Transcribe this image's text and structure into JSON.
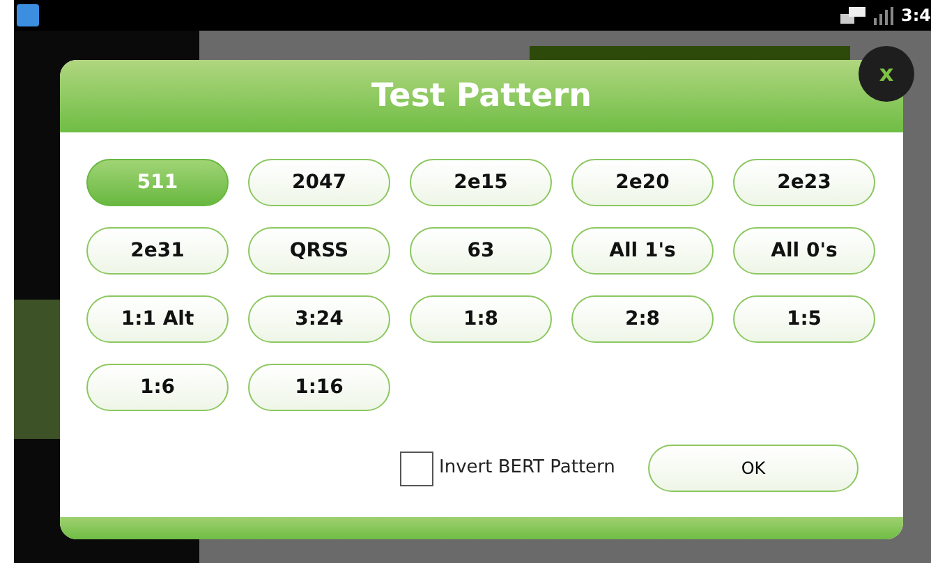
{
  "status_bar": {
    "time": "3:4"
  },
  "dialog": {
    "title": "Test Pattern",
    "close": "x",
    "patterns": [
      {
        "label": "511",
        "selected": true
      },
      {
        "label": "2047",
        "selected": false
      },
      {
        "label": "2e15",
        "selected": false
      },
      {
        "label": "2e20",
        "selected": false
      },
      {
        "label": "2e23",
        "selected": false
      },
      {
        "label": "2e31",
        "selected": false
      },
      {
        "label": "QRSS",
        "selected": false
      },
      {
        "label": "63",
        "selected": false
      },
      {
        "label": "All 1's",
        "selected": false
      },
      {
        "label": "All 0's",
        "selected": false
      },
      {
        "label": "1:1 Alt",
        "selected": false
      },
      {
        "label": "3:24",
        "selected": false
      },
      {
        "label": "1:8",
        "selected": false
      },
      {
        "label": "2:8",
        "selected": false
      },
      {
        "label": "1:5",
        "selected": false
      },
      {
        "label": "1:6",
        "selected": false
      },
      {
        "label": "1:16",
        "selected": false
      }
    ],
    "invert": {
      "label": "Invert BERT Pattern",
      "checked": false
    },
    "ok": "OK"
  }
}
